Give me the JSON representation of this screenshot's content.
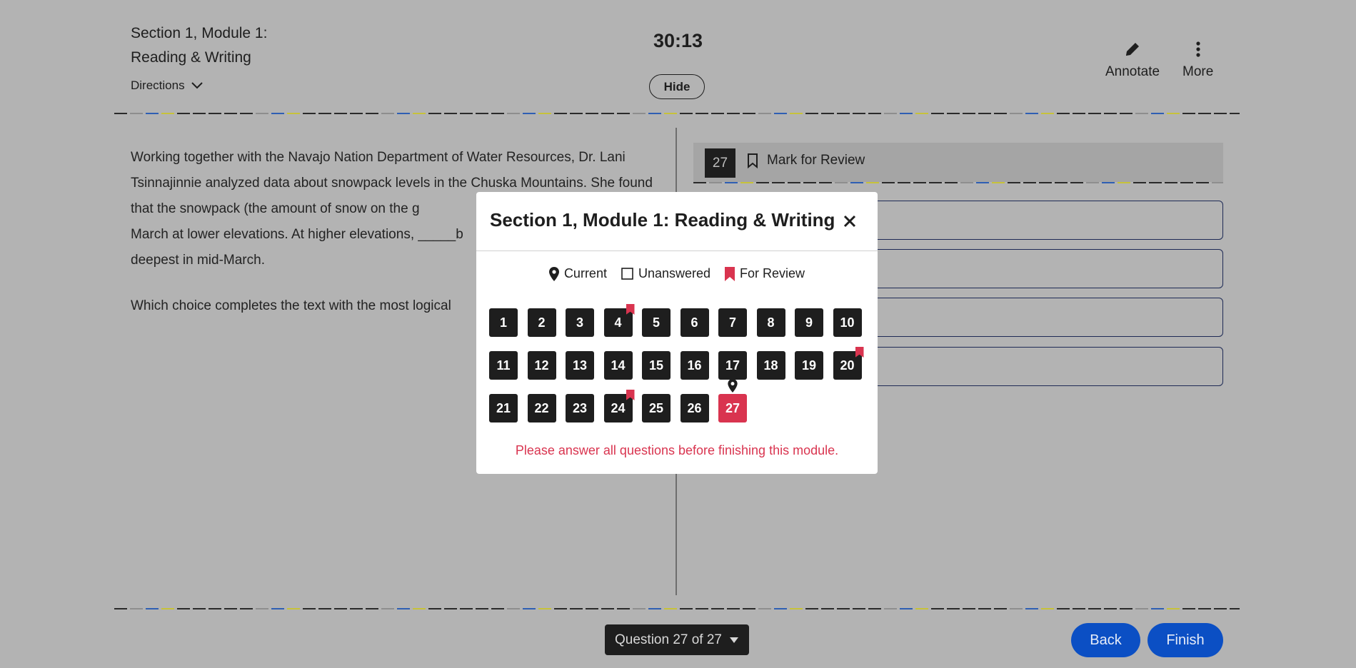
{
  "header": {
    "section_title": "Section 1, Module 1: Reading & Writing",
    "directions_label": "Directions",
    "timer": "30:13",
    "hide_label": "Hide",
    "annotate_label": "Annotate",
    "more_label": "More"
  },
  "passage": {
    "paragraph": "Working together with the Navajo Nation Department of Water Resources, Dr. Lani Tsinnajinnie analyzed data about snowpack levels in the Chuska Mountains. She found that the snowpack (the amount of snow on the g\nMarch at lower elevations. At higher elevations, _____b\ndeepest in mid-March.",
    "prompt": "Which choice completes the text with the most logical"
  },
  "question": {
    "number": "27",
    "mark_for_review_label": "Mark for Review"
  },
  "modal": {
    "title": "Section 1, Module 1: Reading & Writing",
    "legend": {
      "current": "Current",
      "unanswered": "Unanswered",
      "for_review": "For Review"
    },
    "questions": [
      {
        "num": "1"
      },
      {
        "num": "2"
      },
      {
        "num": "3"
      },
      {
        "num": "4",
        "review": true
      },
      {
        "num": "5"
      },
      {
        "num": "6"
      },
      {
        "num": "7"
      },
      {
        "num": "8"
      },
      {
        "num": "9"
      },
      {
        "num": "10"
      },
      {
        "num": "11"
      },
      {
        "num": "12"
      },
      {
        "num": "13"
      },
      {
        "num": "14"
      },
      {
        "num": "15"
      },
      {
        "num": "16"
      },
      {
        "num": "17"
      },
      {
        "num": "18"
      },
      {
        "num": "19"
      },
      {
        "num": "20",
        "review": true
      },
      {
        "num": "21"
      },
      {
        "num": "22"
      },
      {
        "num": "23"
      },
      {
        "num": "24",
        "review": true
      },
      {
        "num": "25"
      },
      {
        "num": "26"
      },
      {
        "num": "27",
        "current": true
      }
    ],
    "warning": "Please answer all questions before finishing this module."
  },
  "footer": {
    "question_nav_label": "Question 27 of 27",
    "back_label": "Back",
    "finish_label": "Finish"
  },
  "colors": {
    "accent_red": "#d9344f",
    "button_blue": "#0b4fc4",
    "dark": "#1e1e1e"
  }
}
